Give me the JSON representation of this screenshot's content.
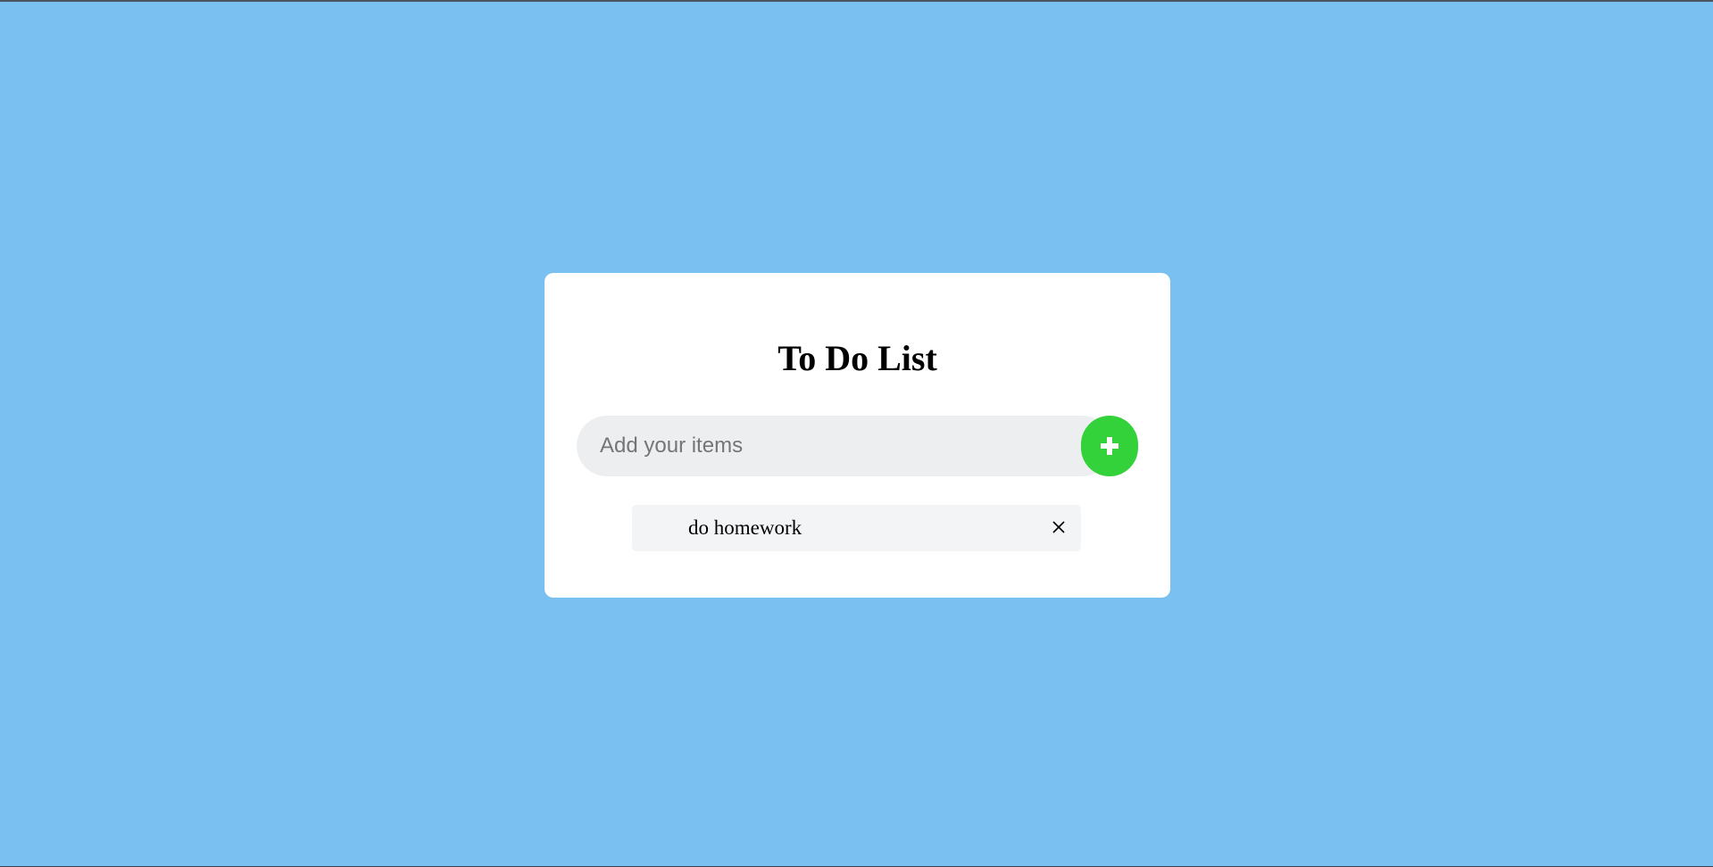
{
  "page": {
    "background_color": "#7ac1f2"
  },
  "card": {
    "title": "To Do List"
  },
  "input": {
    "placeholder": "Add your items",
    "value": ""
  },
  "add_button": {
    "icon": "plus-icon",
    "color": "#33d13a"
  },
  "todos": [
    {
      "text": "do homework",
      "remove_icon": "close-icon"
    }
  ]
}
